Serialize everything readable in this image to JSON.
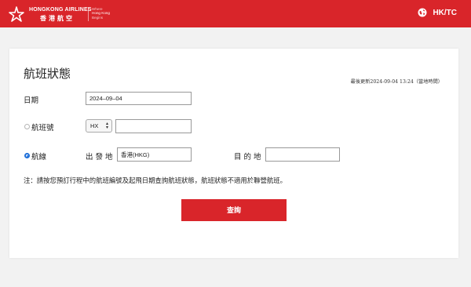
{
  "header": {
    "brand_en": "HONGKONG AIRLINES",
    "brand_zh": "香港航空",
    "tagline": [
      "Where",
      "Hong Kong",
      "Begins"
    ],
    "language": "HK/TC",
    "brand_color": "#d9252a"
  },
  "main": {
    "title": "航班狀態",
    "last_updated": "最後更新2024-09-04 13:24（當地時間）",
    "date_label": "日期",
    "date_value": "2024–09–04",
    "flight_no_label": "航班號",
    "airline_code": "HX",
    "flight_no_value": "",
    "route_label": "航線",
    "origin_label": "出 發 地",
    "origin_value": "香港(HKG)",
    "destination_label": "目 的 地",
    "destination_value": "",
    "note": "注：請按您預訂行程中的航班編號及起飛日期查詢航班狀態，航班狀態不適用於聯營航班。",
    "search_button": "查詢",
    "selected_mode": "route"
  },
  "icons": {
    "logo": "hongkong-airlines-logo",
    "language": "globe-icon",
    "select_arrows": "up-down-arrows-icon"
  }
}
